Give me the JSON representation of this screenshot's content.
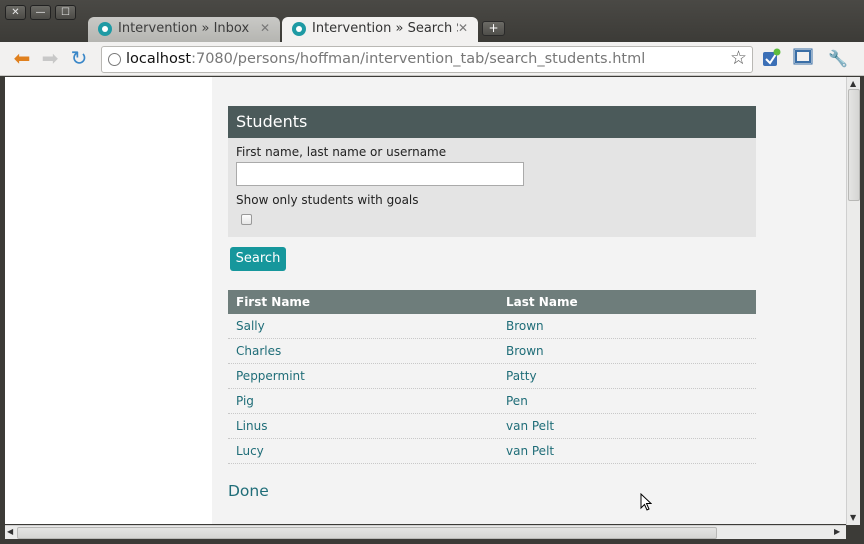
{
  "window": {
    "close_glyph": "✕",
    "minimize_glyph": "—",
    "maximize_glyph": "☐"
  },
  "tabs": [
    {
      "title": "Intervention » Inbox",
      "icon": "app-logo-icon",
      "active": false
    },
    {
      "title": "Intervention » Search Stud",
      "icon": "app-logo-icon",
      "active": true
    }
  ],
  "tab_close_glyph": "✕",
  "new_tab_glyph": "+",
  "toolbar": {
    "back_glyph": "⬅",
    "forward_glyph": "➡",
    "reload_glyph": "↻",
    "url_host": "localhost",
    "url_rest": ":7080/persons/hoffman/intervention_tab/search_students.html",
    "bookmark_star": "☆",
    "wrench_glyph": "🔧"
  },
  "panel": {
    "title": "Students",
    "name_label": "First name, last name or username",
    "name_value": "",
    "goals_label": "Show only students with goals",
    "goals_checked": false
  },
  "search_button": "Search",
  "table": {
    "headers": [
      "First Name",
      "Last Name"
    ],
    "rows": [
      {
        "first": "Sally",
        "last": "Brown"
      },
      {
        "first": "Charles",
        "last": "Brown"
      },
      {
        "first": "Peppermint",
        "last": "Patty"
      },
      {
        "first": "Pig",
        "last": "Pen"
      },
      {
        "first": "Linus",
        "last": "van Pelt"
      },
      {
        "first": "Lucy",
        "last": "van Pelt"
      }
    ]
  },
  "done_link": "Done",
  "colors": {
    "accent": "#16979c",
    "header": "#4b5a5a",
    "table_header": "#6e7d7b",
    "link": "#1f6d78"
  }
}
